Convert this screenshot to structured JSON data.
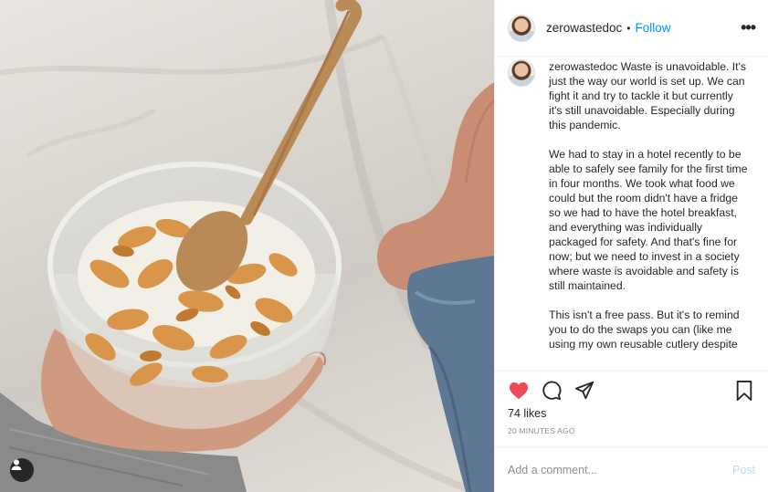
{
  "post": {
    "username": "zerowastedoc",
    "separator": "•",
    "follow_label": "Follow",
    "more_icon": "more-horizontal-icon",
    "caption": {
      "username": "zerowastedoc",
      "paragraph_1": "Waste is unavoidable. It's just the way our world is set up. We can fight it and try to tackle it but currently it's still unavoidable. Especially during this pandemic.",
      "paragraph_2": "We had to stay in a hotel recently to be able to safely see family for the first time in four months. We took what food we could but the room didn't have a fridge so we had to have the hotel breakfast, and everything was individually packaged for safety. And that's fine for now; but we need to invest in a society where waste is avoidable and safety is still maintained.",
      "paragraph_3": "This isn't a free pass. But it's to remind you to do the swaps you can (like me using my own reusable cutlery despite"
    },
    "likes": "74 likes",
    "timestamp": "20 MINUTES AGO",
    "liked": true,
    "colors": {
      "like": "#ed4956",
      "follow": "#0095f6",
      "post_button": "#b2dffc"
    }
  },
  "comment": {
    "placeholder": "Add a comment...",
    "post_label": "Post"
  }
}
